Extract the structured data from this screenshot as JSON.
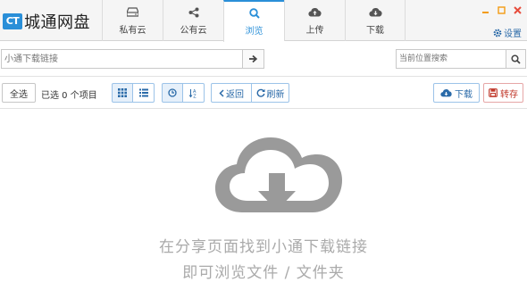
{
  "app": {
    "badge": "CT",
    "name": "城通网盘"
  },
  "tabs": [
    {
      "label": "私有云",
      "icon": "drive-icon"
    },
    {
      "label": "公有云",
      "icon": "share-icon"
    },
    {
      "label": "浏览",
      "icon": "search-icon",
      "active": true
    },
    {
      "label": "上传",
      "icon": "cloud-upload-icon"
    },
    {
      "label": "下载",
      "icon": "cloud-download-icon"
    }
  ],
  "window": {
    "settings_label": "设置"
  },
  "linkbar": {
    "link_placeholder": "小通下载链接",
    "search_placeholder": "当前位置搜索"
  },
  "toolbar": {
    "select_all": "全选",
    "selected_text": "已选 0 个项目",
    "back": "返回",
    "refresh": "刷新",
    "download": "下载",
    "save": "转存"
  },
  "empty_state": {
    "line1": "在分享页面找到小通下载链接",
    "line2": "即可浏览文件 / 文件夹",
    "icon": "cloud-download-icon"
  },
  "colors": {
    "accent": "#2a8fd8",
    "save": "#c0392b",
    "empty_text": "#aaaaaa"
  }
}
